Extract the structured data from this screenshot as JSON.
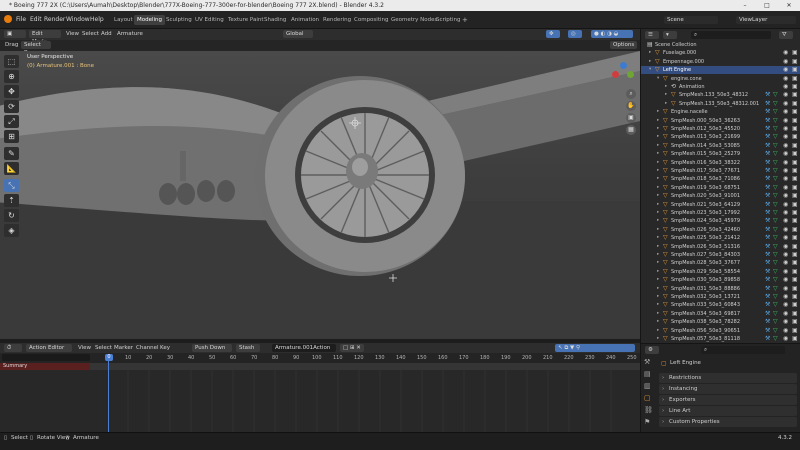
{
  "window": {
    "title": "* Boeing 777 2X (C:\\Users\\Aumah\\Desktop\\Blender\\777X-Boeing-777-300er-for-blender\\Boeing 777 2X.blend) - Blender 4.3.2",
    "minimize": "–",
    "maximize": "□",
    "close": "✕"
  },
  "menu": {
    "items": [
      "File",
      "Edit",
      "Render",
      "Window",
      "Help"
    ],
    "workspaces": [
      "Layout",
      "Modeling",
      "Sculpting",
      "UV Editing",
      "Texture Paint",
      "Shading",
      "Animation",
      "Rendering",
      "Compositing",
      "Geometry Nodes",
      "Scripting"
    ],
    "active_workspace": "Modeling",
    "add_tab": "+",
    "scene": "Scene",
    "view_layer": "ViewLayer"
  },
  "viewport_header": {
    "mode": "Edit Mode",
    "items": [
      "View",
      "Select",
      "Add",
      "Armature"
    ],
    "orientation": "Global",
    "options": "Options",
    "drag_label": "Drag",
    "drag_value": "Select Box"
  },
  "viewport": {
    "perspective": "User Perspective",
    "object_info": "(0) Armature.001 : Bone"
  },
  "tools": [
    "select-box",
    "cursor",
    "move",
    "rotate",
    "scale",
    "transform",
    "annotate",
    "measure",
    "bone-size",
    "extrude",
    "roll",
    "bendy",
    "envelope"
  ],
  "outliner": {
    "search_placeholder": "",
    "rows": [
      {
        "name": "Scene Collection",
        "indent": 0,
        "icon": "collection",
        "tri": ""
      },
      {
        "name": "Fuselage.000",
        "indent": 1,
        "icon": "object",
        "tri": ">"
      },
      {
        "name": "Empennage.000",
        "indent": 1,
        "icon": "object",
        "tri": ">"
      },
      {
        "name": "Left Engine",
        "indent": 1,
        "icon": "object",
        "tri": "v",
        "selected": true
      },
      {
        "name": "engine.cone",
        "indent": 2,
        "icon": "object",
        "tri": "v"
      },
      {
        "name": "Animation",
        "indent": 3,
        "icon": "anim",
        "tri": ">"
      },
      {
        "name": "SmpMesh.133_50e3_48312",
        "indent": 3,
        "icon": "mesh",
        "tri": ">"
      },
      {
        "name": "SmpMesh.133_50e3_48312.001",
        "indent": 3,
        "icon": "mesh",
        "tri": ">"
      },
      {
        "name": "Engine.nacelle",
        "indent": 2,
        "icon": "mesh",
        "tri": ">"
      },
      {
        "name": "SmpMesh.000_50e3_36263",
        "indent": 2,
        "icon": "mesh",
        "tri": ">"
      },
      {
        "name": "SmpMesh.012_50e3_45520",
        "indent": 2,
        "icon": "mesh",
        "tri": ">"
      },
      {
        "name": "SmpMesh.013_50e3_21699",
        "indent": 2,
        "icon": "mesh",
        "tri": ">"
      },
      {
        "name": "SmpMesh.014_50e3_53085",
        "indent": 2,
        "icon": "mesh",
        "tri": ">"
      },
      {
        "name": "SmpMesh.015_50e3_25279",
        "indent": 2,
        "icon": "mesh",
        "tri": ">"
      },
      {
        "name": "SmpMesh.016_50e3_38322",
        "indent": 2,
        "icon": "mesh",
        "tri": ">"
      },
      {
        "name": "SmpMesh.017_50e3_77671",
        "indent": 2,
        "icon": "mesh",
        "tri": ">"
      },
      {
        "name": "SmpMesh.018_50e3_71086",
        "indent": 2,
        "icon": "mesh",
        "tri": ">"
      },
      {
        "name": "SmpMesh.019_50e3_68751",
        "indent": 2,
        "icon": "mesh",
        "tri": ">"
      },
      {
        "name": "SmpMesh.020_50e3_91001",
        "indent": 2,
        "icon": "mesh",
        "tri": ">"
      },
      {
        "name": "SmpMesh.021_50e3_64129",
        "indent": 2,
        "icon": "mesh",
        "tri": ">"
      },
      {
        "name": "SmpMesh.023_50e3_17992",
        "indent": 2,
        "icon": "mesh",
        "tri": ">"
      },
      {
        "name": "SmpMesh.024_50e3_45979",
        "indent": 2,
        "icon": "mesh",
        "tri": ">"
      },
      {
        "name": "SmpMesh.026_50e3_42460",
        "indent": 2,
        "icon": "mesh",
        "tri": ">"
      },
      {
        "name": "SmpMesh.025_50e3_21412",
        "indent": 2,
        "icon": "mesh",
        "tri": ">"
      },
      {
        "name": "SmpMesh.026_50e3_51316",
        "indent": 2,
        "icon": "mesh",
        "tri": ">"
      },
      {
        "name": "SmpMesh.027_50e3_84303",
        "indent": 2,
        "icon": "mesh",
        "tri": ">"
      },
      {
        "name": "SmpMesh.028_50e3_37677",
        "indent": 2,
        "icon": "mesh",
        "tri": ">"
      },
      {
        "name": "SmpMesh.029_50e3_58554",
        "indent": 2,
        "icon": "mesh",
        "tri": ">"
      },
      {
        "name": "SmpMesh.030_50e3_89858",
        "indent": 2,
        "icon": "mesh",
        "tri": ">"
      },
      {
        "name": "SmpMesh.031_50e3_88886",
        "indent": 2,
        "icon": "mesh",
        "tri": ">"
      },
      {
        "name": "SmpMesh.032_50e3_13721",
        "indent": 2,
        "icon": "mesh",
        "tri": ">"
      },
      {
        "name": "SmpMesh.033_50e3_60843",
        "indent": 2,
        "icon": "mesh",
        "tri": ">"
      },
      {
        "name": "SmpMesh.034_50e3_69817",
        "indent": 2,
        "icon": "mesh",
        "tri": ">"
      },
      {
        "name": "SmpMesh.038_50e3_78282",
        "indent": 2,
        "icon": "mesh",
        "tri": ">"
      },
      {
        "name": "SmpMesh.056_50e3_90651",
        "indent": 2,
        "icon": "mesh",
        "tri": ">"
      },
      {
        "name": "SmpMesh.057_50e3_81118",
        "indent": 2,
        "icon": "mesh",
        "tri": ">"
      }
    ]
  },
  "properties": {
    "object_name": "Left Engine",
    "panels": [
      "Restrictions",
      "Instancing",
      "Exporters",
      "Line Art",
      "Custom Properties"
    ]
  },
  "action_editor": {
    "editor": "Action Editor",
    "menus": [
      "View",
      "Select",
      "Marker",
      "Channel",
      "Key"
    ],
    "push_down": "Push Down",
    "stash": "Stash",
    "action": "Armature.001Action",
    "current_frame": "0",
    "frames": [
      "10",
      "20",
      "30",
      "40",
      "50",
      "60",
      "70",
      "80",
      "90",
      "100",
      "110",
      "120",
      "130",
      "140",
      "150",
      "160",
      "170",
      "180",
      "190",
      "200",
      "210",
      "220",
      "230",
      "240",
      "250"
    ],
    "summary": "Summary"
  },
  "status": {
    "items": [
      "Select",
      "Rotate View",
      "Armature"
    ],
    "version": "4.3.2"
  },
  "colors": {
    "accent": "#4772b3",
    "selected_row": "#334d80",
    "summary_row": "#5a2020",
    "playhead": "#4a7fd4"
  }
}
